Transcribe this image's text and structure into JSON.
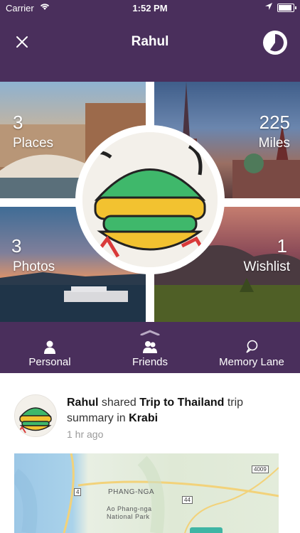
{
  "status_bar": {
    "carrier": "Carrier",
    "time": "1:52 PM"
  },
  "header": {
    "title": "Rahul"
  },
  "tiles": [
    {
      "number": "3",
      "label": "Places"
    },
    {
      "number": "225",
      "label": "Miles"
    },
    {
      "number": "3",
      "label": "Photos"
    },
    {
      "number": "1",
      "label": "Wishlist"
    }
  ],
  "tabs": [
    {
      "label": "Personal",
      "icon": "person-icon"
    },
    {
      "label": "Friends",
      "icon": "people-icon"
    },
    {
      "label": "Memory Lane",
      "icon": "chat-icon"
    }
  ],
  "post": {
    "user": "Rahul",
    "verb": "shared",
    "trip": "Trip to Thailand",
    "after_trip": "trip summary in",
    "place": "Krabi",
    "time_ago": "1 hr ago"
  },
  "map": {
    "region_label": "PHANG-NGA",
    "park_label_1": "Ao Phang-nga",
    "park_label_2": "National Park",
    "route_4009": "4009",
    "route_4": "4",
    "route_44": "44"
  },
  "colors": {
    "brand_purple": "#4a2f5c",
    "accent_teal": "#3fb5a4"
  }
}
